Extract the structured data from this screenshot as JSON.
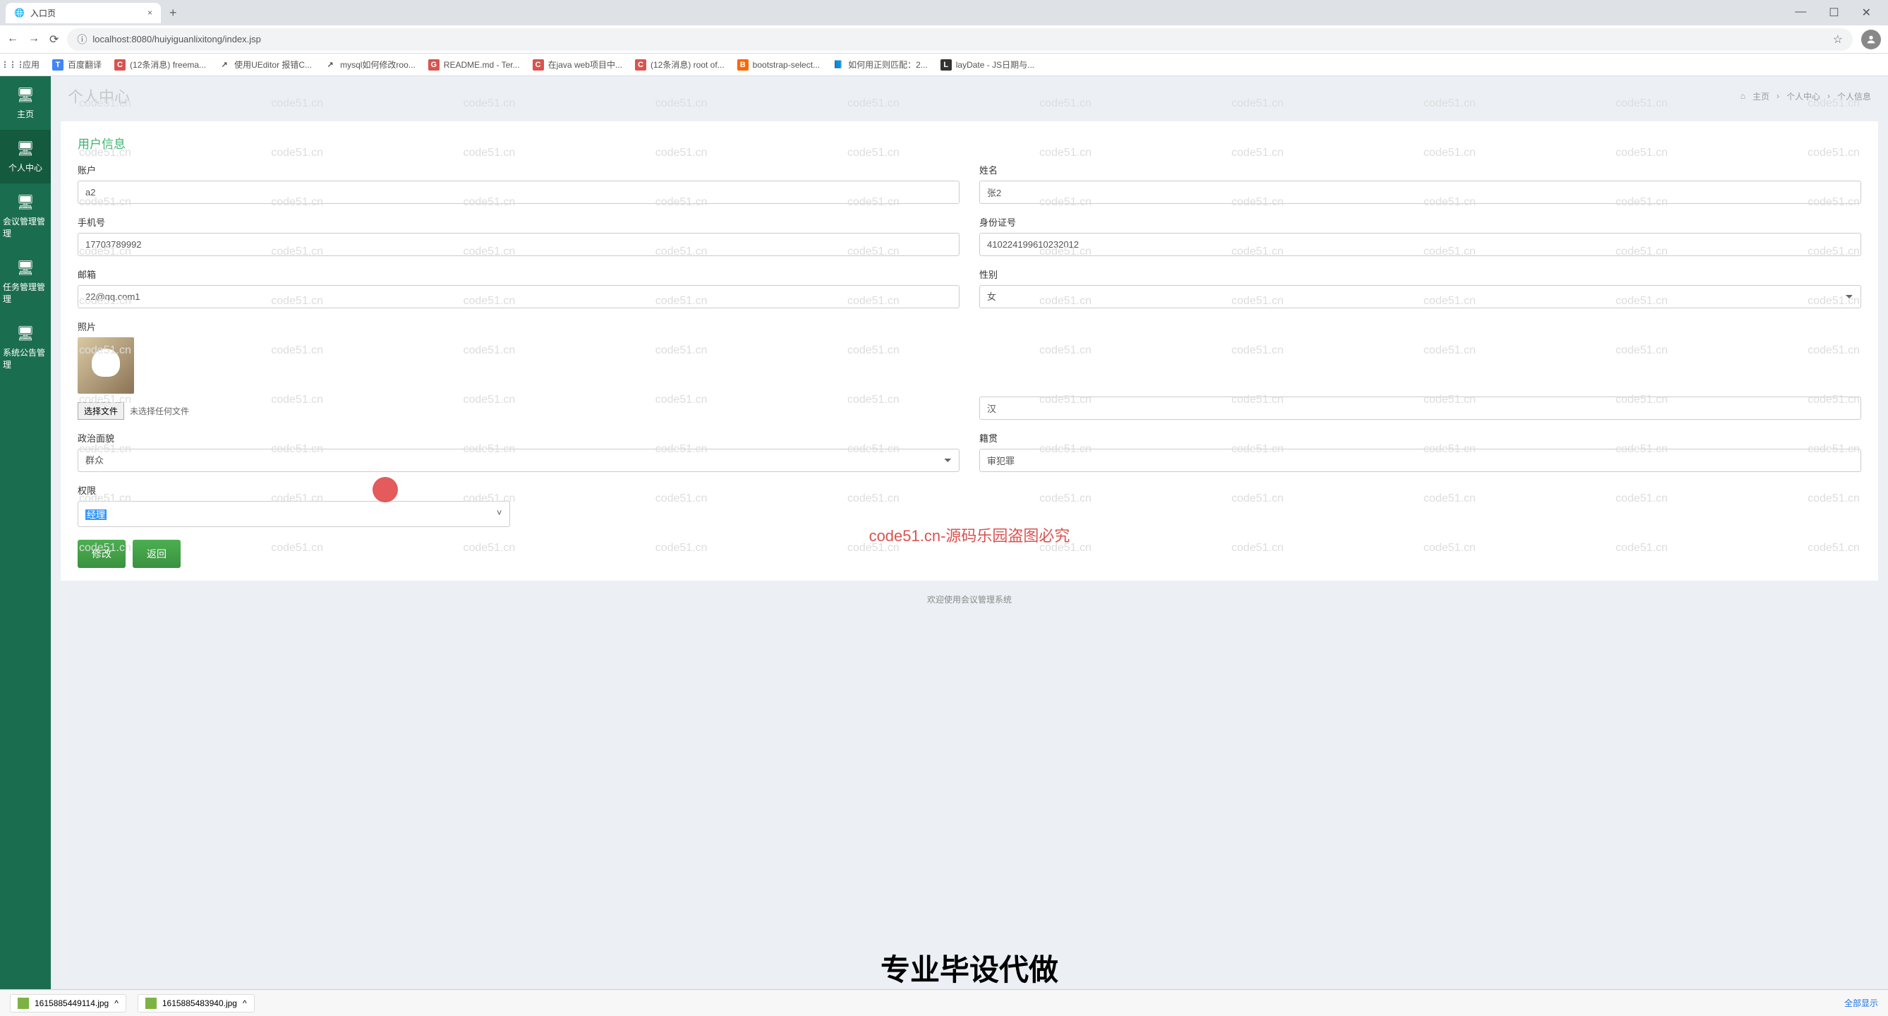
{
  "browser": {
    "tab_title": "入口页",
    "url": "localhost:8080/huiyiguanlixitong/index.jsp",
    "bookmarks": [
      {
        "icon": "apps",
        "label": "应用"
      },
      {
        "icon": "T",
        "color": "#4285f4",
        "label": "百度翻译"
      },
      {
        "icon": "C",
        "color": "#d9534f",
        "label": "(12条消息) freema..."
      },
      {
        "icon": "↗",
        "label": "使用UEditor 报错C..."
      },
      {
        "icon": "↗",
        "label": "mysql如何修改roo..."
      },
      {
        "icon": "G",
        "color": "#d9534f",
        "label": "README.md - Ter..."
      },
      {
        "icon": "C",
        "color": "#d9534f",
        "label": "在java web项目中..."
      },
      {
        "icon": "C",
        "color": "#d9534f",
        "label": "(12条消息) root of..."
      },
      {
        "icon": "B",
        "color": "#ff6600",
        "label": "bootstrap-select..."
      },
      {
        "icon": "📘",
        "label": "如何用正则匹配：2..."
      },
      {
        "icon": "L",
        "color": "#333",
        "label": "layDate - JS日期与..."
      }
    ]
  },
  "sidebar": {
    "items": [
      {
        "label": "主页",
        "icon": "monitor"
      },
      {
        "label": "个人中心",
        "icon": "monitor"
      },
      {
        "label": "会议管理管理",
        "icon": "monitor"
      },
      {
        "label": "任务管理管理",
        "icon": "monitor"
      },
      {
        "label": "系统公告管理",
        "icon": "monitor"
      }
    ]
  },
  "header": {
    "title": "个人中心",
    "breadcrumb": [
      "主页",
      "个人中心",
      "个人信息"
    ]
  },
  "card": {
    "title": "用户信息",
    "fields": {
      "account_label": "账户",
      "account_value": "a2",
      "name_label": "姓名",
      "name_value": "张2",
      "phone_label": "手机号",
      "phone_value": "17703789992",
      "idcard_label": "身份证号",
      "idcard_value": "410224199610232012",
      "email_label": "邮箱",
      "email_value": "22@qq.com1",
      "gender_label": "性别",
      "gender_value": "女",
      "photo_label": "照片",
      "ethnic_value": "汉",
      "file_btn": "选择文件",
      "file_text": "未选择任何文件",
      "political_label": "政治面貌",
      "political_value": "群众",
      "origin_label": "籍贯",
      "origin_value": "审犯罪",
      "perm_label": "权限",
      "perm_value": "经理"
    },
    "buttons": {
      "submit": "修改",
      "back": "返回"
    }
  },
  "watermark": {
    "text": "code51.cn",
    "red": "code51.cn-源码乐园盗图必究"
  },
  "overlay": {
    "big": "专业毕设代做"
  },
  "footer": "欢迎使用会议管理系统",
  "downloads": {
    "items": [
      "1615885449114.jpg",
      "1615885483940.jpg"
    ],
    "all": "全部显示"
  }
}
